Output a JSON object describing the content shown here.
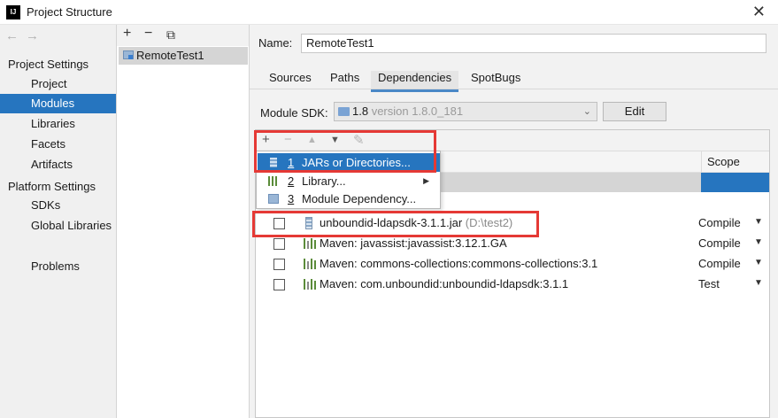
{
  "window": {
    "title": "Project Structure",
    "app_icon": "IJ"
  },
  "nav": {
    "back": "←",
    "forward": "→",
    "group1": "Project Settings",
    "group1_items": [
      "Project",
      "Modules",
      "Libraries",
      "Facets",
      "Artifacts"
    ],
    "group2": "Platform Settings",
    "group2_items": [
      "SDKs",
      "Global Libraries"
    ],
    "problems": "Problems",
    "selected": "Modules"
  },
  "modules": {
    "add": "+",
    "remove": "−",
    "copy": "⧉",
    "items": [
      "RemoteTest1"
    ]
  },
  "details": {
    "name_label": "Name:",
    "name_value": "RemoteTest1",
    "tabs": [
      "Sources",
      "Paths",
      "Dependencies",
      "SpotBugs"
    ],
    "active_tab": "Dependencies",
    "sdk_label": "Module SDK:",
    "sdk_value": "1.8",
    "sdk_version": "version 1.8.0_181",
    "edit_label": "Edit",
    "scope_header": "Scope"
  },
  "popup": {
    "items": [
      {
        "num": "1",
        "label": "JARs or Directories..."
      },
      {
        "num": "2",
        "label": "Library..."
      },
      {
        "num": "3",
        "label": "Module Dependency..."
      }
    ]
  },
  "dependencies": [
    {
      "name": "unboundid-ldapsdk-3.1.1.jar",
      "path": "(D:\\test2)",
      "scope": "Compile",
      "icon": "jar-icon"
    },
    {
      "name": "Maven: javassist:javassist:3.12.1.GA",
      "path": "",
      "scope": "Compile",
      "icon": "library-icon"
    },
    {
      "name": "Maven: commons-collections:commons-collections:3.1",
      "path": "",
      "scope": "Compile",
      "icon": "library-icon"
    },
    {
      "name": "Maven: com.unboundid:unboundid-ldapsdk:3.1.1",
      "path": "",
      "scope": "Test",
      "icon": "library-icon"
    }
  ],
  "colors": {
    "selection": "#2675bf",
    "highlight_box": "#e53935",
    "library_green": "#5b8c3a"
  }
}
